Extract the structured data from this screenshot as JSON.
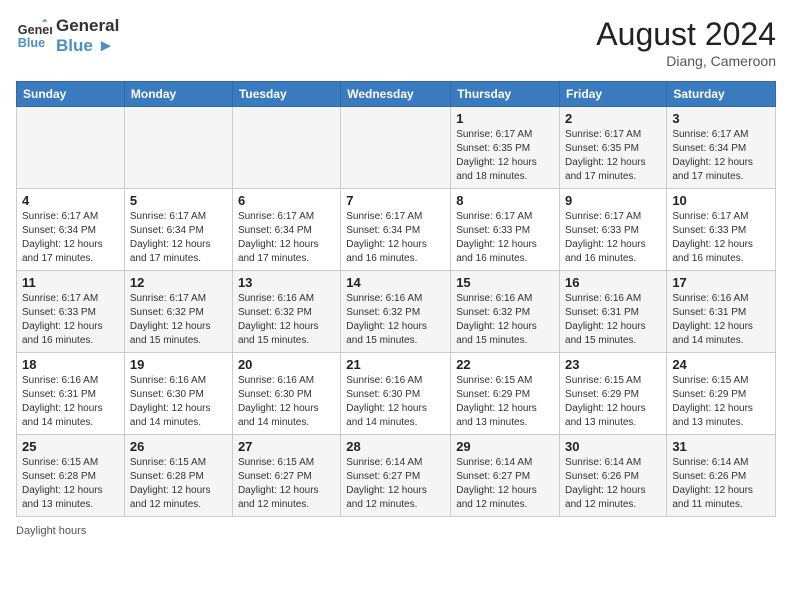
{
  "header": {
    "logo_general": "General",
    "logo_blue": "Blue",
    "month_year": "August 2024",
    "location": "Diang, Cameroon"
  },
  "days_of_week": [
    "Sunday",
    "Monday",
    "Tuesday",
    "Wednesday",
    "Thursday",
    "Friday",
    "Saturday"
  ],
  "weeks": [
    [
      {
        "day": "",
        "info": ""
      },
      {
        "day": "",
        "info": ""
      },
      {
        "day": "",
        "info": ""
      },
      {
        "day": "",
        "info": ""
      },
      {
        "day": "1",
        "info": "Sunrise: 6:17 AM\nSunset: 6:35 PM\nDaylight: 12 hours and 18 minutes."
      },
      {
        "day": "2",
        "info": "Sunrise: 6:17 AM\nSunset: 6:35 PM\nDaylight: 12 hours and 17 minutes."
      },
      {
        "day": "3",
        "info": "Sunrise: 6:17 AM\nSunset: 6:34 PM\nDaylight: 12 hours and 17 minutes."
      }
    ],
    [
      {
        "day": "4",
        "info": "Sunrise: 6:17 AM\nSunset: 6:34 PM\nDaylight: 12 hours and 17 minutes."
      },
      {
        "day": "5",
        "info": "Sunrise: 6:17 AM\nSunset: 6:34 PM\nDaylight: 12 hours and 17 minutes."
      },
      {
        "day": "6",
        "info": "Sunrise: 6:17 AM\nSunset: 6:34 PM\nDaylight: 12 hours and 17 minutes."
      },
      {
        "day": "7",
        "info": "Sunrise: 6:17 AM\nSunset: 6:34 PM\nDaylight: 12 hours and 16 minutes."
      },
      {
        "day": "8",
        "info": "Sunrise: 6:17 AM\nSunset: 6:33 PM\nDaylight: 12 hours and 16 minutes."
      },
      {
        "day": "9",
        "info": "Sunrise: 6:17 AM\nSunset: 6:33 PM\nDaylight: 12 hours and 16 minutes."
      },
      {
        "day": "10",
        "info": "Sunrise: 6:17 AM\nSunset: 6:33 PM\nDaylight: 12 hours and 16 minutes."
      }
    ],
    [
      {
        "day": "11",
        "info": "Sunrise: 6:17 AM\nSunset: 6:33 PM\nDaylight: 12 hours and 16 minutes."
      },
      {
        "day": "12",
        "info": "Sunrise: 6:17 AM\nSunset: 6:32 PM\nDaylight: 12 hours and 15 minutes."
      },
      {
        "day": "13",
        "info": "Sunrise: 6:16 AM\nSunset: 6:32 PM\nDaylight: 12 hours and 15 minutes."
      },
      {
        "day": "14",
        "info": "Sunrise: 6:16 AM\nSunset: 6:32 PM\nDaylight: 12 hours and 15 minutes."
      },
      {
        "day": "15",
        "info": "Sunrise: 6:16 AM\nSunset: 6:32 PM\nDaylight: 12 hours and 15 minutes."
      },
      {
        "day": "16",
        "info": "Sunrise: 6:16 AM\nSunset: 6:31 PM\nDaylight: 12 hours and 15 minutes."
      },
      {
        "day": "17",
        "info": "Sunrise: 6:16 AM\nSunset: 6:31 PM\nDaylight: 12 hours and 14 minutes."
      }
    ],
    [
      {
        "day": "18",
        "info": "Sunrise: 6:16 AM\nSunset: 6:31 PM\nDaylight: 12 hours and 14 minutes."
      },
      {
        "day": "19",
        "info": "Sunrise: 6:16 AM\nSunset: 6:30 PM\nDaylight: 12 hours and 14 minutes."
      },
      {
        "day": "20",
        "info": "Sunrise: 6:16 AM\nSunset: 6:30 PM\nDaylight: 12 hours and 14 minutes."
      },
      {
        "day": "21",
        "info": "Sunrise: 6:16 AM\nSunset: 6:30 PM\nDaylight: 12 hours and 14 minutes."
      },
      {
        "day": "22",
        "info": "Sunrise: 6:15 AM\nSunset: 6:29 PM\nDaylight: 12 hours and 13 minutes."
      },
      {
        "day": "23",
        "info": "Sunrise: 6:15 AM\nSunset: 6:29 PM\nDaylight: 12 hours and 13 minutes."
      },
      {
        "day": "24",
        "info": "Sunrise: 6:15 AM\nSunset: 6:29 PM\nDaylight: 12 hours and 13 minutes."
      }
    ],
    [
      {
        "day": "25",
        "info": "Sunrise: 6:15 AM\nSunset: 6:28 PM\nDaylight: 12 hours and 13 minutes."
      },
      {
        "day": "26",
        "info": "Sunrise: 6:15 AM\nSunset: 6:28 PM\nDaylight: 12 hours and 12 minutes."
      },
      {
        "day": "27",
        "info": "Sunrise: 6:15 AM\nSunset: 6:27 PM\nDaylight: 12 hours and 12 minutes."
      },
      {
        "day": "28",
        "info": "Sunrise: 6:14 AM\nSunset: 6:27 PM\nDaylight: 12 hours and 12 minutes."
      },
      {
        "day": "29",
        "info": "Sunrise: 6:14 AM\nSunset: 6:27 PM\nDaylight: 12 hours and 12 minutes."
      },
      {
        "day": "30",
        "info": "Sunrise: 6:14 AM\nSunset: 6:26 PM\nDaylight: 12 hours and 12 minutes."
      },
      {
        "day": "31",
        "info": "Sunrise: 6:14 AM\nSunset: 6:26 PM\nDaylight: 12 hours and 11 minutes."
      }
    ]
  ],
  "footer": {
    "note": "Daylight hours"
  }
}
